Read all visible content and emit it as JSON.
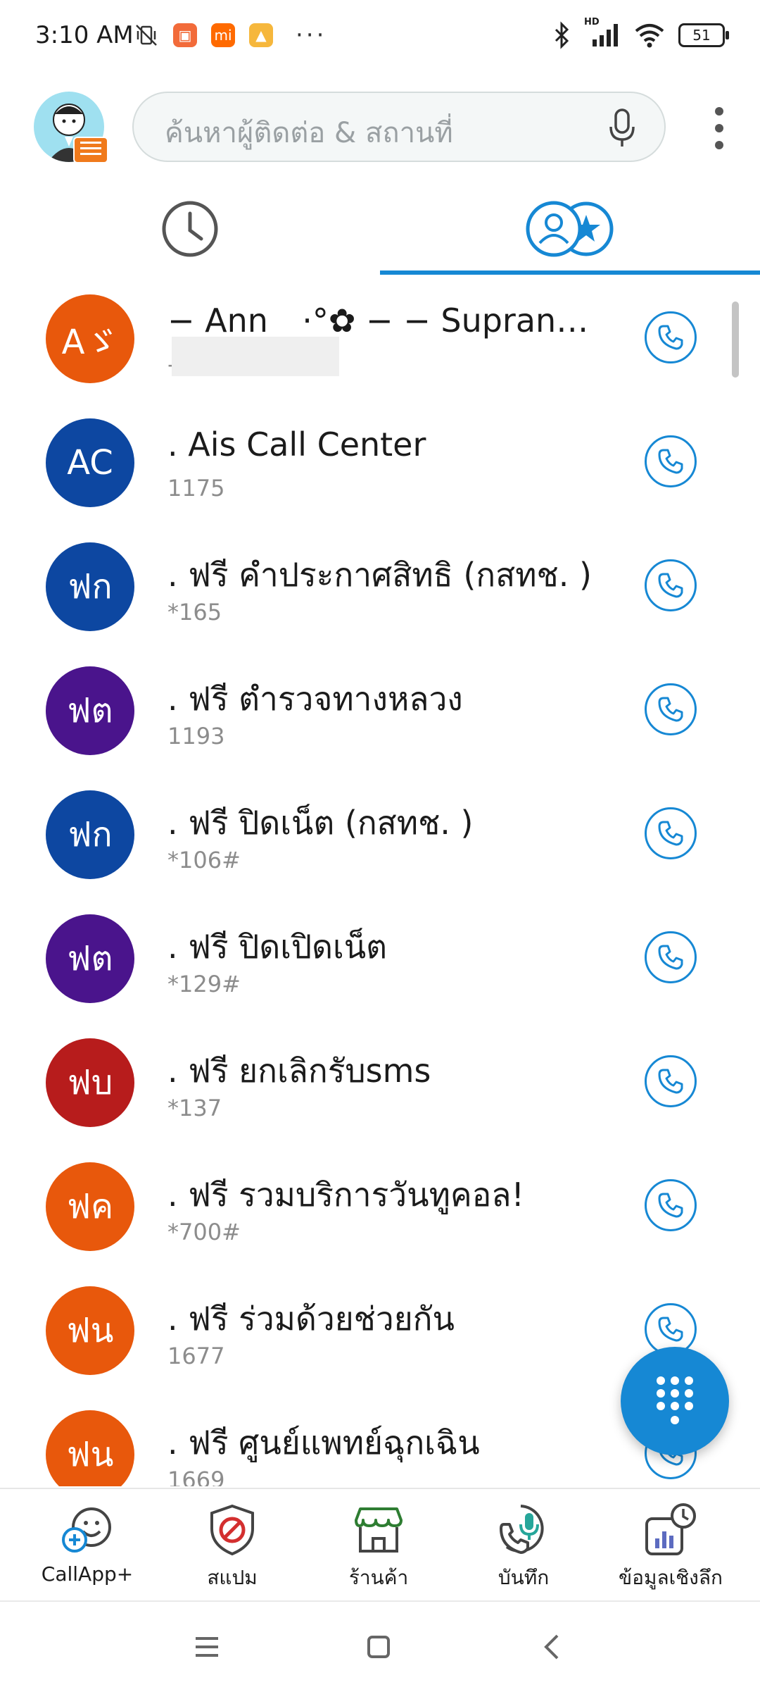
{
  "status_bar": {
    "time": "3:10 AM",
    "left_icons": [
      "muted-vibrate-icon",
      "mi-store-icon",
      "mi-icon",
      "gallery-icon"
    ],
    "more": "···",
    "network_label": "HD",
    "battery": "51"
  },
  "search": {
    "placeholder": "ค้นหาผู้ติดต่อ & สถานที่"
  },
  "tabs": [
    {
      "name": "recent",
      "icon": "clock-icon",
      "selected": false
    },
    {
      "name": "contacts-favorites",
      "icon": "contacts-star-icon",
      "selected": true
    }
  ],
  "contacts": [
    {
      "initials": "Aゞ",
      "color": "#e8580c",
      "name": "− Ann ⠀·°✿ − − Supranee....",
      "number": "-"
    },
    {
      "initials": "AC",
      "color": "#0d47a1",
      "name": ". Ais Call Center",
      "number": "1175"
    },
    {
      "initials": "ฟก",
      "color": "#0d47a1",
      "name": ". ฟรี คำประกาศสิทธิ (กสทช. )",
      "number": "*165"
    },
    {
      "initials": "ฟต",
      "color": "#4a148c",
      "name": ". ฟรี ตำรวจทางหลวง",
      "number": "1193"
    },
    {
      "initials": "ฟก",
      "color": "#0d47a1",
      "name": ". ฟรี ปิดเน็ต (กสทช. )",
      "number": "*106#"
    },
    {
      "initials": "ฟต",
      "color": "#4a148c",
      "name": ". ฟรี ปิดเปิดเน็ต",
      "number": "*129#"
    },
    {
      "initials": "ฟบ",
      "color": "#b71c1c",
      "name": ". ฟรี ยกเลิกรับsms",
      "number": "*137"
    },
    {
      "initials": "ฟค",
      "color": "#e8580c",
      "name": ". ฟรี รวมบริการวันทูคอล!",
      "number": "*700#"
    },
    {
      "initials": "ฟน",
      "color": "#e8580c",
      "name": ". ฟรี ร่วมด้วยช่วยกัน",
      "number": "1677"
    },
    {
      "initials": "ฟน",
      "color": "#e8580c",
      "name": ". ฟรี ศูนย์แพทย์ฉุกเฉิน",
      "number": "1669"
    }
  ],
  "bottom_nav": [
    {
      "label": "CallApp+",
      "icon": "callapp-plus-icon"
    },
    {
      "label": "สแปม",
      "icon": "spam-shield-icon"
    },
    {
      "label": "ร้านค้า",
      "icon": "store-icon"
    },
    {
      "label": "บันทึก",
      "icon": "call-recorder-icon"
    },
    {
      "label": "ข้อมูลเชิงลึก",
      "icon": "insights-icon"
    }
  ],
  "colors": {
    "accent": "#1688d4",
    "store_green": "#2e7d32"
  }
}
